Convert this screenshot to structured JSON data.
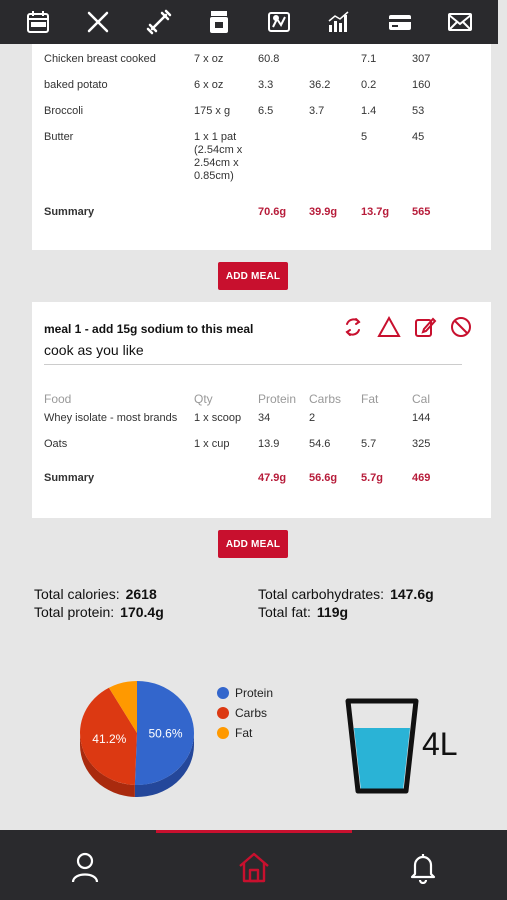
{
  "top_nav": {
    "icons": [
      "calendar-icon",
      "utensils-icon",
      "dumbbell-icon",
      "supplement-icon",
      "progress-photo-icon",
      "stats-chart-icon",
      "payment-card-icon",
      "mail-icon"
    ]
  },
  "meal_previous": {
    "rows": [
      {
        "food": "Chicken breast cooked",
        "qty": "7 x oz",
        "protein": "60.8",
        "carbs": "",
        "fat": "7.1",
        "cal": "307"
      },
      {
        "food": "baked potato",
        "qty": "6 x oz",
        "protein": "3.3",
        "carbs": "36.2",
        "fat": "0.2",
        "cal": "160"
      },
      {
        "food": "Broccoli",
        "qty": "175 x g",
        "protein": "6.5",
        "carbs": "3.7",
        "fat": "1.4",
        "cal": "53"
      },
      {
        "food": "Butter",
        "qty": "1 x 1 pat (2.54cm x 2.54cm x 0.85cm)",
        "protein": "",
        "carbs": "",
        "fat": "5",
        "cal": "45"
      }
    ],
    "summary": {
      "label": "Summary",
      "protein": "70.6g",
      "carbs": "39.9g",
      "fat": "13.7g",
      "cal": "565"
    }
  },
  "add_meal_label": "ADD MEAL",
  "meal_1": {
    "title": "meal 1 - add 15g sodium to this meal",
    "note": "cook as you like",
    "headers": {
      "food": "Food",
      "qty": "Qty",
      "protein": "Protein",
      "carbs": "Carbs",
      "fat": "Fat",
      "cal": "Cal"
    },
    "rows": [
      {
        "food": "Whey isolate - most brands",
        "qty": "1 x scoop",
        "protein": "34",
        "carbs": "2",
        "fat": "",
        "cal": "144"
      },
      {
        "food": "Oats",
        "qty": "1 x cup",
        "protein": "13.9",
        "carbs": "54.6",
        "fat": "5.7",
        "cal": "325"
      }
    ],
    "summary": {
      "label": "Summary",
      "protein": "47.9g",
      "carbs": "56.6g",
      "fat": "5.7g",
      "cal": "469"
    }
  },
  "totals": {
    "calories_label": "Total calories:",
    "calories": "2618",
    "protein_label": "Total protein:",
    "protein": "170.4g",
    "carbs_label": "Total carbohydrates:",
    "carbs": "147.6g",
    "fat_label": "Total fat:",
    "fat": "119g"
  },
  "chart_data": {
    "type": "pie",
    "categories": [
      "Protein",
      "Carbs",
      "Fat"
    ],
    "values": [
      50.6,
      41.2,
      8.2
    ],
    "slice_labels": [
      "50.6%",
      "41.2%",
      ""
    ],
    "colors": [
      "#3366cc",
      "#dc3912",
      "#ff9900"
    ],
    "legend": "right"
  },
  "water": {
    "label": "4L",
    "fill_fraction": 0.65
  },
  "bottom_nav": {
    "icons": [
      "profile-icon",
      "home-icon",
      "notifications-icon"
    ],
    "active": "home-icon",
    "accent": "#c8102e"
  }
}
